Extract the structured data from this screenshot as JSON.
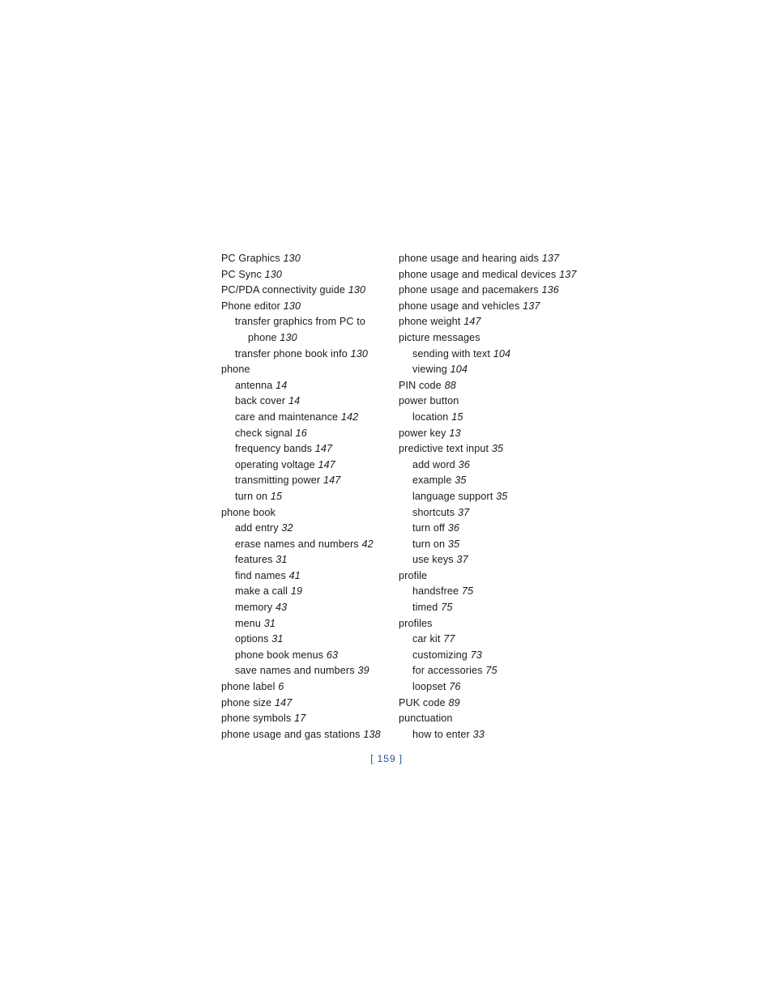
{
  "document": {
    "type": "book-index",
    "page_label": "[ 159 ]",
    "page_number_color": "#2b5797",
    "text_color": "#1a1a1a",
    "background_color": "#ffffff"
  },
  "columns": [
    {
      "name": "left-column",
      "entries": [
        {
          "level": 0,
          "term": "PC Graphics",
          "page": "130"
        },
        {
          "level": 0,
          "term": "PC Sync",
          "page": "130"
        },
        {
          "level": 0,
          "term": "PC/PDA connectivity guide",
          "page": "130"
        },
        {
          "level": 0,
          "term": "Phone editor",
          "page": "130"
        },
        {
          "level": 1,
          "term": "transfer graphics from PC to",
          "page": ""
        },
        {
          "level": 2,
          "term": "phone",
          "page": "130"
        },
        {
          "level": 1,
          "term": "transfer phone book info",
          "page": "130"
        },
        {
          "level": 0,
          "term": "phone",
          "page": ""
        },
        {
          "level": 1,
          "term": "antenna",
          "page": "14"
        },
        {
          "level": 1,
          "term": "back cover",
          "page": "14"
        },
        {
          "level": 1,
          "term": "care and maintenance",
          "page": "142"
        },
        {
          "level": 1,
          "term": "check signal",
          "page": "16"
        },
        {
          "level": 1,
          "term": "frequency bands",
          "page": "147"
        },
        {
          "level": 1,
          "term": "operating voltage",
          "page": "147"
        },
        {
          "level": 1,
          "term": "transmitting power",
          "page": "147"
        },
        {
          "level": 1,
          "term": "turn on",
          "page": "15"
        },
        {
          "level": 0,
          "term": "phone book",
          "page": ""
        },
        {
          "level": 1,
          "term": "add entry",
          "page": "32"
        },
        {
          "level": 1,
          "term": "erase names and numbers",
          "page": "42"
        },
        {
          "level": 1,
          "term": "features",
          "page": "31"
        },
        {
          "level": 1,
          "term": "find names",
          "page": "41"
        },
        {
          "level": 1,
          "term": "make a call",
          "page": "19"
        },
        {
          "level": 1,
          "term": "memory",
          "page": "43"
        },
        {
          "level": 1,
          "term": "menu",
          "page": "31"
        },
        {
          "level": 1,
          "term": "options",
          "page": "31"
        },
        {
          "level": 1,
          "term": "phone book menus",
          "page": "63"
        },
        {
          "level": 1,
          "term": "save names and numbers",
          "page": "39"
        },
        {
          "level": 0,
          "term": "phone label",
          "page": "6"
        },
        {
          "level": 0,
          "term": "phone size",
          "page": "147"
        },
        {
          "level": 0,
          "term": "phone symbols",
          "page": "17"
        },
        {
          "level": 0,
          "term": "phone usage and gas stations",
          "page": "138"
        }
      ]
    },
    {
      "name": "right-column",
      "entries": [
        {
          "level": 0,
          "term": "phone usage and hearing aids",
          "page": "137"
        },
        {
          "level": 0,
          "term": "phone usage and medical devices",
          "page": "137"
        },
        {
          "level": 0,
          "term": "phone usage and pacemakers",
          "page": "136"
        },
        {
          "level": 0,
          "term": "phone usage and vehicles",
          "page": "137"
        },
        {
          "level": 0,
          "term": "phone weight",
          "page": "147"
        },
        {
          "level": 0,
          "term": "picture messages",
          "page": ""
        },
        {
          "level": 1,
          "term": "sending with text",
          "page": "104"
        },
        {
          "level": 1,
          "term": "viewing",
          "page": "104"
        },
        {
          "level": 0,
          "term": "PIN code",
          "page": "88"
        },
        {
          "level": 0,
          "term": "power button",
          "page": ""
        },
        {
          "level": 1,
          "term": "location",
          "page": "15"
        },
        {
          "level": 0,
          "term": "power key",
          "page": "13"
        },
        {
          "level": 0,
          "term": "predictive text input",
          "page": "35"
        },
        {
          "level": 1,
          "term": "add word",
          "page": "36"
        },
        {
          "level": 1,
          "term": "example",
          "page": "35"
        },
        {
          "level": 1,
          "term": "language support",
          "page": "35"
        },
        {
          "level": 1,
          "term": "shortcuts",
          "page": "37"
        },
        {
          "level": 1,
          "term": "turn off",
          "page": "36"
        },
        {
          "level": 1,
          "term": "turn on",
          "page": "35"
        },
        {
          "level": 1,
          "term": "use keys",
          "page": "37"
        },
        {
          "level": 0,
          "term": "profile",
          "page": ""
        },
        {
          "level": 1,
          "term": "handsfree",
          "page": "75"
        },
        {
          "level": 1,
          "term": "timed",
          "page": "75"
        },
        {
          "level": 0,
          "term": "profiles",
          "page": ""
        },
        {
          "level": 1,
          "term": "car kit",
          "page": "77"
        },
        {
          "level": 1,
          "term": "customizing",
          "page": "73"
        },
        {
          "level": 1,
          "term": "for accessories",
          "page": "75"
        },
        {
          "level": 1,
          "term": "loopset",
          "page": "76"
        },
        {
          "level": 0,
          "term": "PUK code",
          "page": "89"
        },
        {
          "level": 0,
          "term": "punctuation",
          "page": ""
        },
        {
          "level": 1,
          "term": "how to enter",
          "page": "33"
        }
      ]
    }
  ]
}
